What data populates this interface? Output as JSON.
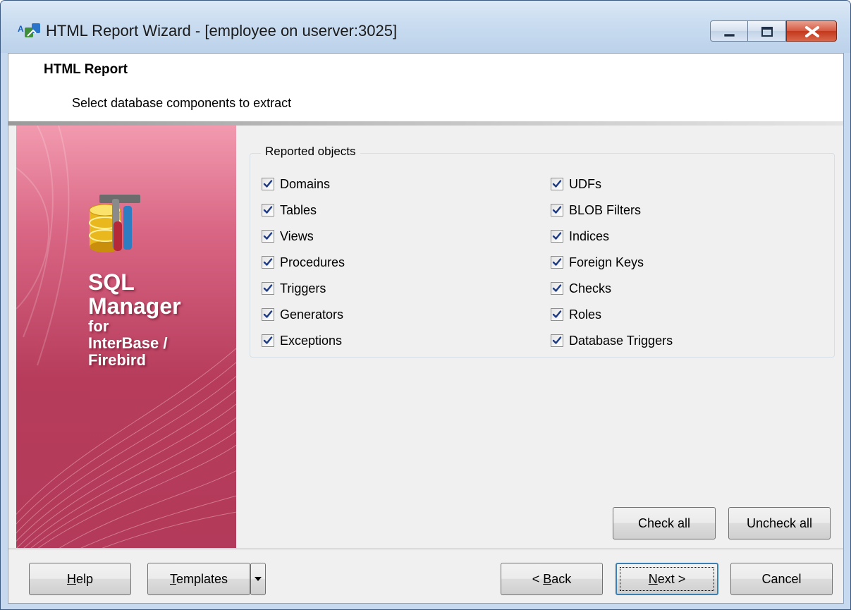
{
  "window": {
    "title": "HTML Report Wizard - [employee on userver:3025]"
  },
  "header": {
    "title": "HTML Report",
    "subtitle": "Select database components to extract"
  },
  "banner": {
    "line1": "SQL",
    "line2": "Manager",
    "line3": "for",
    "line4": "InterBase /",
    "line5": "Firebird"
  },
  "group": {
    "label": "Reported objects",
    "left_items": [
      {
        "label": "Domains",
        "checked": true
      },
      {
        "label": "Tables",
        "checked": true
      },
      {
        "label": "Views",
        "checked": true
      },
      {
        "label": "Procedures",
        "checked": true
      },
      {
        "label": "Triggers",
        "checked": true
      },
      {
        "label": "Generators",
        "checked": true
      },
      {
        "label": "Exceptions",
        "checked": true
      }
    ],
    "right_items": [
      {
        "label": "UDFs",
        "checked": true
      },
      {
        "label": "BLOB Filters",
        "checked": true
      },
      {
        "label": "Indices",
        "checked": true
      },
      {
        "label": "Foreign Keys",
        "checked": true
      },
      {
        "label": "Checks",
        "checked": true
      },
      {
        "label": "Roles",
        "checked": true
      },
      {
        "label": "Database Triggers",
        "checked": true
      }
    ]
  },
  "actions": {
    "check_all": "Check all",
    "uncheck_all": "Uncheck all"
  },
  "footer": {
    "help_mnemonic": "H",
    "help_rest": "elp",
    "templates_mnemonic": "T",
    "templates_rest": "emplates",
    "back_prefix": "< ",
    "back_mnemonic": "B",
    "back_rest": "ack",
    "next_mnemonic": "N",
    "next_rest": "ext >",
    "cancel": "Cancel"
  },
  "colors": {
    "banner_top": "#f29aaf",
    "banner_bottom": "#b33a5a",
    "check_color": "#1d3b85"
  }
}
